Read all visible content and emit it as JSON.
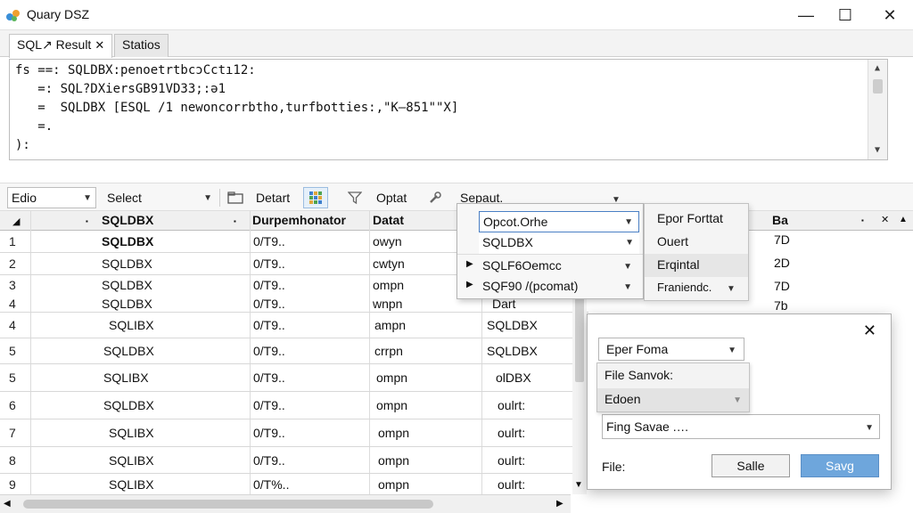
{
  "window": {
    "title": "Quary DSZ",
    "minimize": "—",
    "maximize": "☐",
    "close": "✕"
  },
  "tabs": [
    {
      "label": "SQL↗ Result",
      "close": "✕"
    },
    {
      "label": "Statios"
    }
  ],
  "editor": {
    "lines": [
      "fs ==: SQLDBX:penoetrtbcɔCctı12:",
      "   =: SQL?DXiersGB91VD33;:ə1",
      "   =  SQLDBX [ESQL /1 newoncorrbtho,turfbotties:,\"K–851\"\"X]",
      "   =.",
      "):"
    ]
  },
  "toolbar": {
    "combo1": "Edio",
    "combo2": "Select",
    "button_detart": "Detart",
    "button_optat": "Optat",
    "label_sepaut": "Sepaut."
  },
  "grid": {
    "headers": [
      "SQLDBX",
      "Durpemhonator",
      "Datat"
    ],
    "rows": [
      {
        "num": "1",
        "c1": "SQLDBX",
        "c2": "0/T9..",
        "c3": "owyn",
        "c4": ""
      },
      {
        "num": "2",
        "c1": "SQLDBX",
        "c2": "0/T9..",
        "c3": "cwtyn",
        "c4": ""
      },
      {
        "num": "3",
        "c1": "SQLDBX",
        "c2": "0/T9..",
        "c3": "ompn",
        "c4": ""
      },
      {
        "num": "4",
        "c1": "SQLDBX",
        "c2": "0/T9..",
        "c3": "wnpn",
        "c4": "Dart"
      },
      {
        "num": "4",
        "c1": "SQLIBX",
        "c2": "0/T9..",
        "c3": "ampn",
        "c4": "SQLDBX"
      },
      {
        "num": "5",
        "c1": "SQLDBX",
        "c2": "0/T9..",
        "c3": "crrpn",
        "c4": "SQLDBX"
      },
      {
        "num": "5",
        "c1": "SQLIBX",
        "c2": "0/T9..",
        "c3": "ompn",
        "c4": "olDBX"
      },
      {
        "num": "6",
        "c1": "SQLDBX",
        "c2": "0/T9..",
        "c3": "ompn",
        "c4": "oulrt:"
      },
      {
        "num": "7",
        "c1": "SQLIBX",
        "c2": "0/T9..",
        "c3": "ompn",
        "c4": "oulrt:"
      },
      {
        "num": "8",
        "c1": "SQLIBX",
        "c2": "0/T9..",
        "c3": "ompn",
        "c4": "oulrt:"
      },
      {
        "num": "9",
        "c1": "SQLIBX",
        "c2": "0/T%..",
        "c3": "ompn",
        "c4": "oulrt:"
      }
    ]
  },
  "right_column": {
    "header": "Ba",
    "values": [
      "7D",
      "2D",
      "7D",
      "7b"
    ]
  },
  "dropdown": {
    "items": [
      {
        "label": "Opcot.Orhe"
      },
      {
        "label": "SQLDBX"
      },
      {
        "label": "SQLF6Oemcc"
      },
      {
        "label": "SQF90 /(pcomat)"
      }
    ],
    "sub_items": [
      "Epor Forttat",
      "Ouert",
      "Erqintal",
      "Franiendc."
    ]
  },
  "dialog": {
    "format_combo": "Eper Foma",
    "list_items": [
      "File Sanvok:",
      "Edoen"
    ],
    "file_combo": "Fing Savae .…",
    "file_label": "File:",
    "cancel": "Salle",
    "save": "Savg"
  }
}
